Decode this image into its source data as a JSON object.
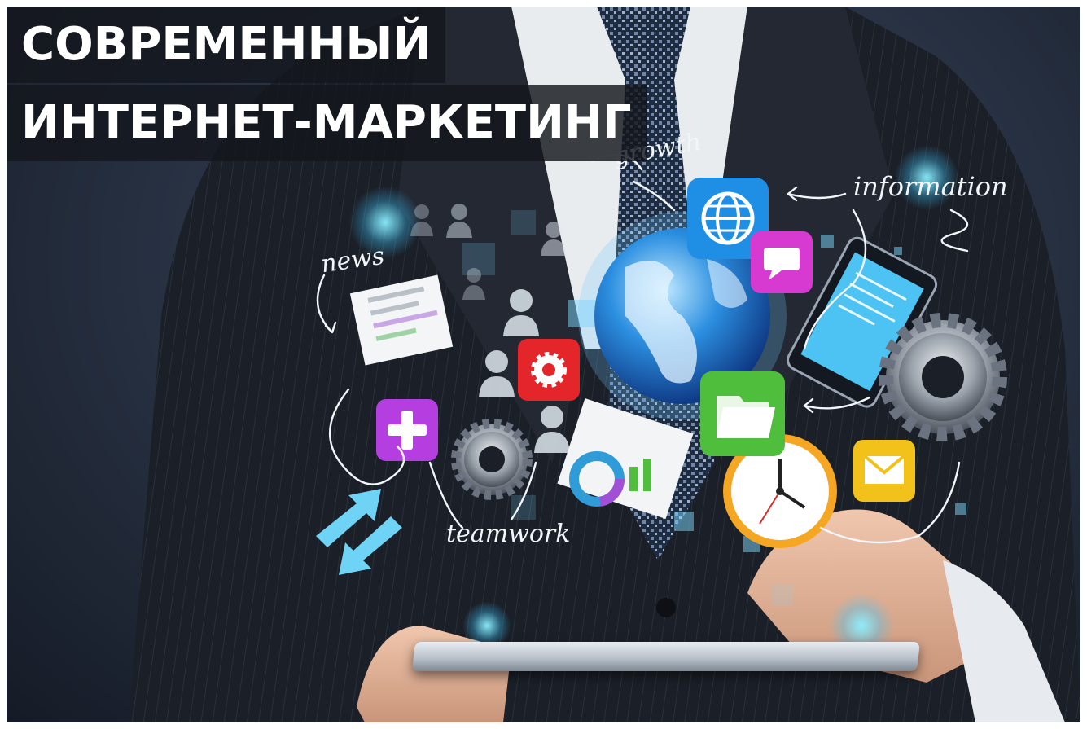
{
  "banner": {
    "title_line1": "СОВРЕМЕННЫЙ",
    "title_line2": "ИНТЕРНЕТ-МАРКЕТИНГ"
  },
  "labels": {
    "growth": "growth",
    "information": "information",
    "news": "news",
    "teamwork": "teamwork"
  },
  "icons": [
    {
      "name": "globe-app-icon",
      "color": "#1f8fe6"
    },
    {
      "name": "chat-app-icon",
      "color": "#d63ad0"
    },
    {
      "name": "settings-app-icon",
      "color": "#e4262b"
    },
    {
      "name": "add-app-icon",
      "color": "#b43ee0"
    },
    {
      "name": "folder-app-icon",
      "color": "#4fbe3c"
    },
    {
      "name": "mail-app-icon",
      "color": "#f2c21a"
    }
  ],
  "colors": {
    "background": "#1e2633",
    "accent_cyan": "#5fd3ff",
    "banner_bg": "#141619",
    "banner_text": "#ffffff"
  }
}
